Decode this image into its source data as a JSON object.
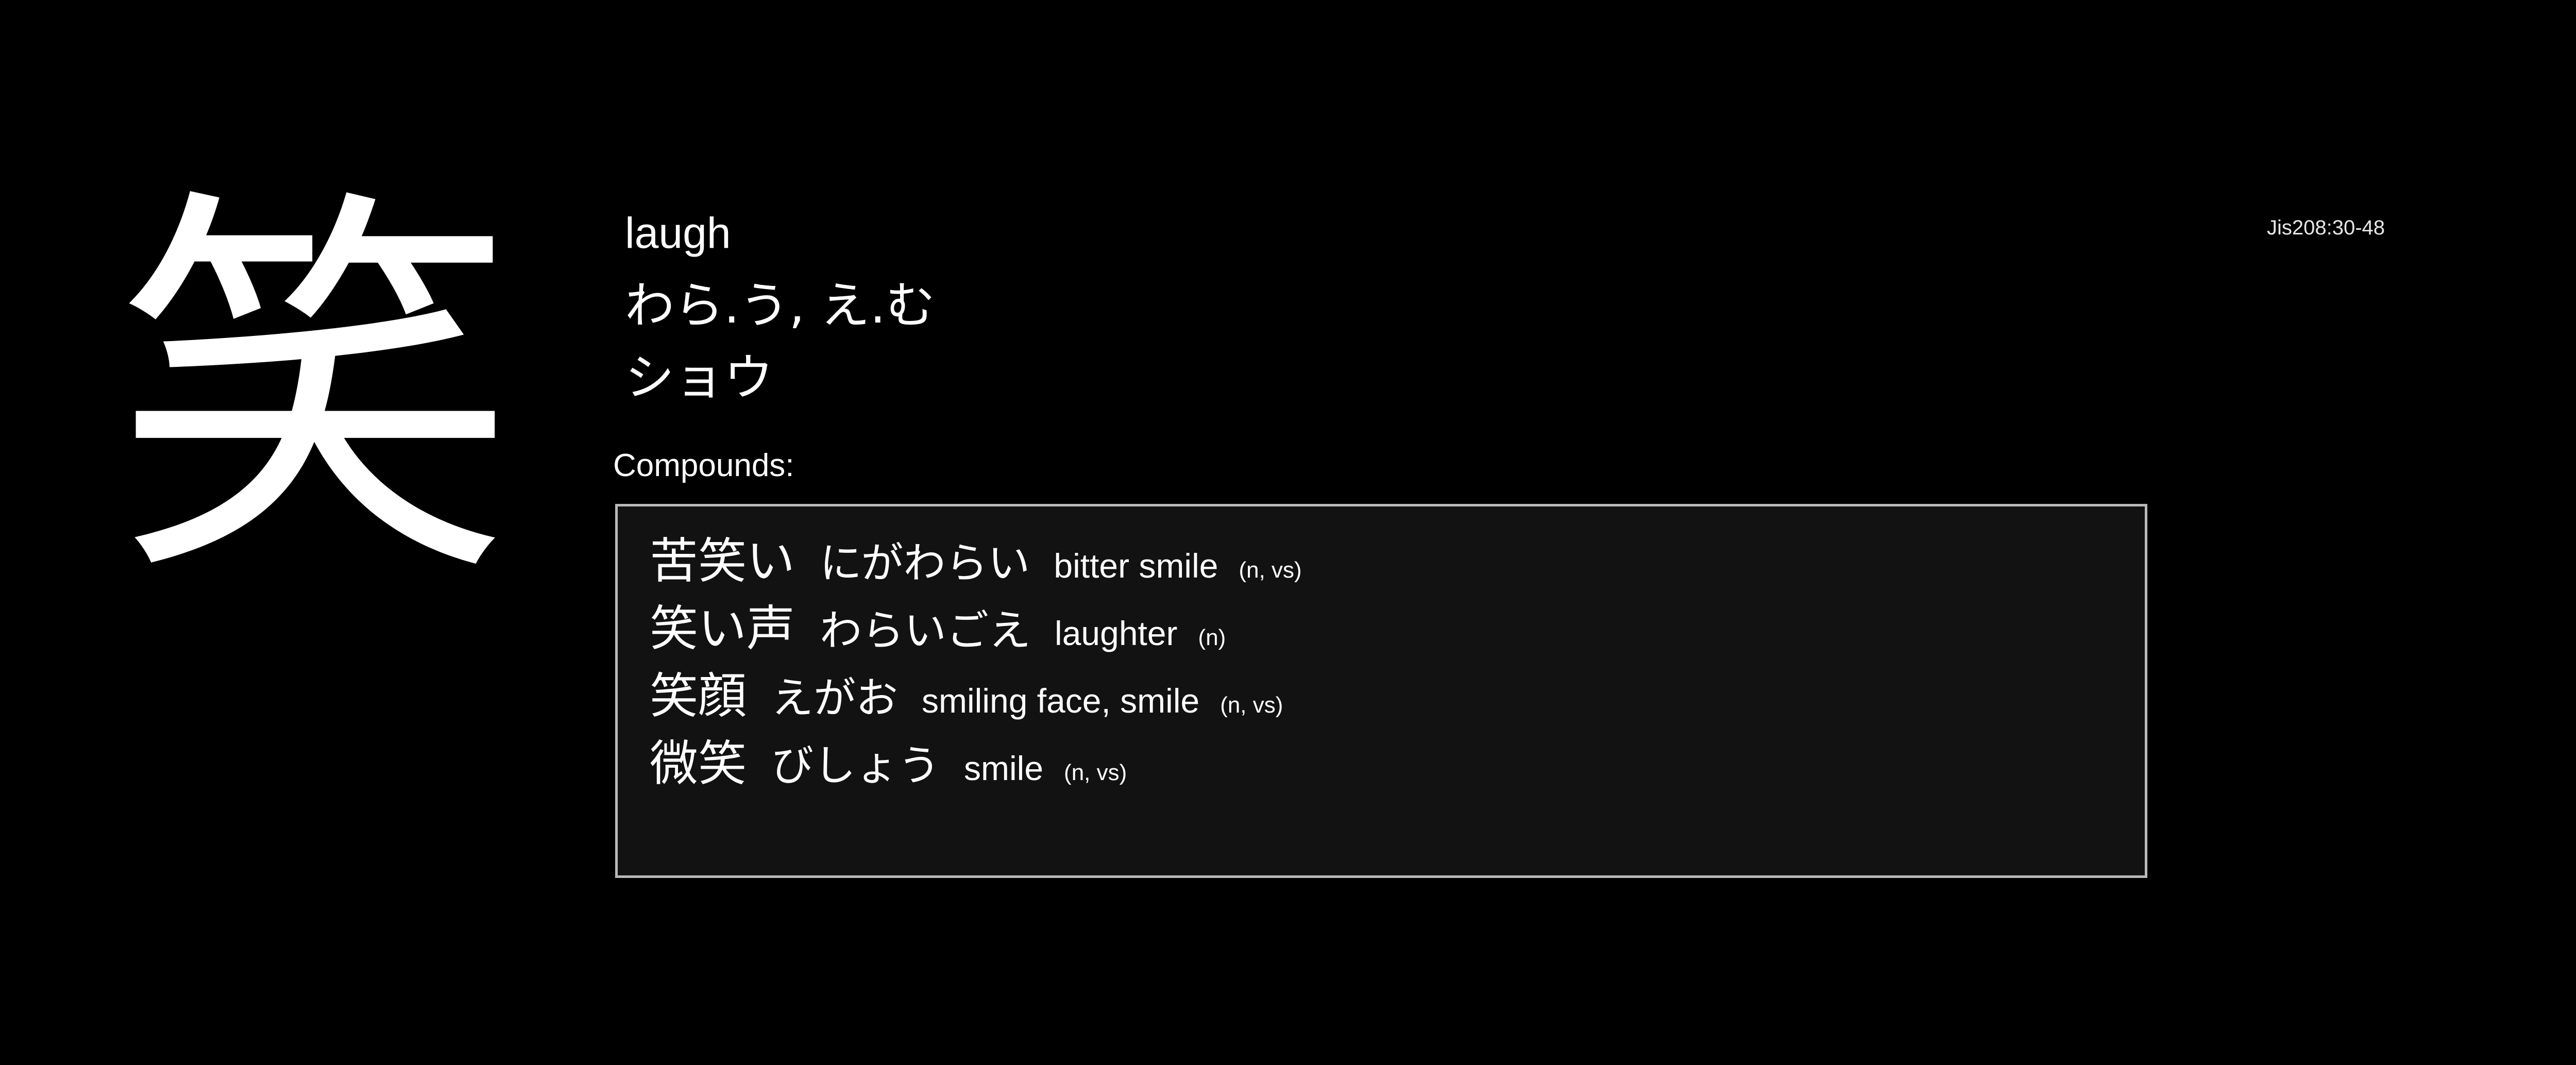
{
  "kanji": "笑",
  "code": "Jis208:30-48",
  "meaning": "laugh",
  "kun_readings": "わら.う, え.む",
  "on_readings": "ショウ",
  "compounds_label": "Compounds:",
  "compounds": [
    {
      "word": "苦笑い",
      "reading": "にがわらい",
      "gloss": "bitter smile",
      "pos": "(n, vs)"
    },
    {
      "word": "笑い声",
      "reading": "わらいごえ",
      "gloss": "laughter",
      "pos": "(n)"
    },
    {
      "word": "笑顔",
      "reading": "えがお",
      "gloss": "smiling face, smile",
      "pos": "(n, vs)"
    },
    {
      "word": "微笑",
      "reading": "びしょう",
      "gloss": "smile",
      "pos": "(n, vs)"
    }
  ]
}
